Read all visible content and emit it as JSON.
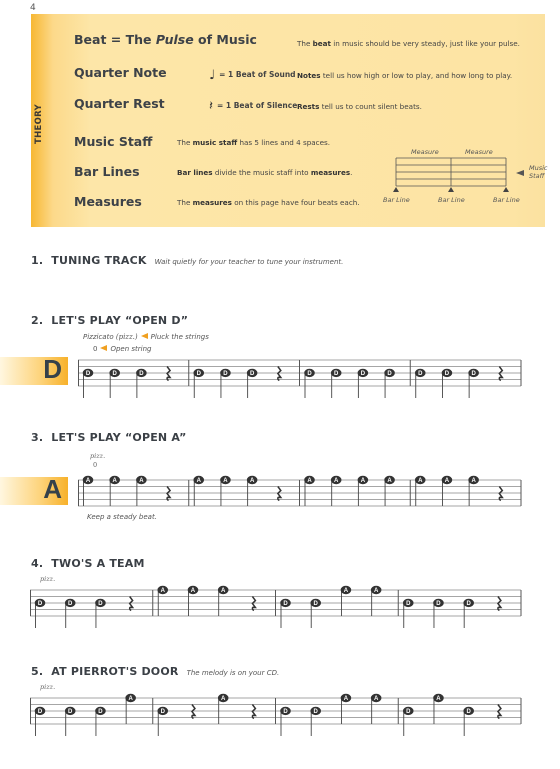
{
  "page_number": "4",
  "theory": {
    "tab_label": "THEORY",
    "rows": [
      {
        "heading": "Beat = The ",
        "heading_italic": "Pulse",
        "heading_after": " of Music",
        "desc_pre": "The ",
        "desc_bold": "beat",
        "desc_post": " in music should be very steady, just like your pulse."
      },
      {
        "heading": "Quarter Note",
        "symbol": "♩",
        "symbol_text": "= 1 Beat of Sound",
        "desc_pre": "",
        "desc_bold": "Notes",
        "desc_post": " tell us how high or low to play, and how long to play."
      },
      {
        "heading": "Quarter Rest",
        "symbol": "𝄽",
        "symbol_text": "= 1 Beat of Silence",
        "desc_pre": "",
        "desc_bold": "Rests",
        "desc_post": " tell us to count silent beats."
      },
      {
        "heading": "Music Staff",
        "desc_pre": "The ",
        "desc_bold": "music staff",
        "desc_post": " has 5 lines and 4 spaces."
      },
      {
        "heading": "Bar Lines",
        "desc_pre": "",
        "desc_bold": "Bar lines",
        "desc_post": " divide the music staff into ",
        "desc_bold2": "measures",
        "desc_post2": "."
      },
      {
        "heading": "Measures",
        "desc_pre": "The ",
        "desc_bold": "measures",
        "desc_post": " on this page have four beats each."
      }
    ],
    "diagram": {
      "measure_label": "Measure",
      "staff_label_1": "Music",
      "staff_label_2": "Staff",
      "bar_line_label": "Bar Line"
    }
  },
  "exercises": [
    {
      "number": "1.",
      "title": "TUNING TRACK",
      "note": "Wait quietly for your teacher to tune your instrument."
    },
    {
      "number": "2.",
      "title": "LET'S PLAY “OPEN D”",
      "note": "",
      "pizz_text": "Pizzicato",
      "pizz_abbr": "(pizz.)",
      "pizz_desc": "Pluck the strings",
      "open_symbol": "0",
      "open_desc": "Open string",
      "tag": "D",
      "measures": [
        [
          "D",
          "D",
          "D",
          "r"
        ],
        [
          "D",
          "D",
          "D",
          "r"
        ],
        [
          "D",
          "D",
          "D",
          "D"
        ],
        [
          "D",
          "D",
          "D",
          "r"
        ]
      ]
    },
    {
      "number": "3.",
      "title": "LET'S PLAY “OPEN A”",
      "note": "",
      "pizz_abbr": "pizz.",
      "open_symbol": "0",
      "tag": "A",
      "footer": "Keep a steady beat.",
      "measures": [
        [
          "A",
          "A",
          "A",
          "r"
        ],
        [
          "A",
          "A",
          "A",
          "r"
        ],
        [
          "A",
          "A",
          "A",
          "A"
        ],
        [
          "A",
          "A",
          "A",
          "r"
        ]
      ]
    },
    {
      "number": "4.",
      "title": "TWO'S A TEAM",
      "note": "",
      "pizz_abbr": "pizz.",
      "measures": [
        [
          "D",
          "D",
          "D",
          "r"
        ],
        [
          "A",
          "A",
          "A",
          "r"
        ],
        [
          "D",
          "D",
          "A",
          "A"
        ],
        [
          "D",
          "D",
          "D",
          "r"
        ]
      ]
    },
    {
      "number": "5.",
      "title": "AT PIERROT'S DOOR",
      "note": "The melody is on your CD.",
      "pizz_abbr": "pizz.",
      "measures": [
        [
          "D",
          "D",
          "D",
          "A"
        ],
        [
          "D",
          "r",
          "A",
          "r"
        ],
        [
          "D",
          "D",
          "A",
          "A"
        ],
        [
          "D",
          "A",
          "D",
          "r"
        ]
      ]
    }
  ],
  "colors": {
    "accent": "#f7b12b",
    "panel": "#fde4a4",
    "ink": "#3a3f45"
  }
}
